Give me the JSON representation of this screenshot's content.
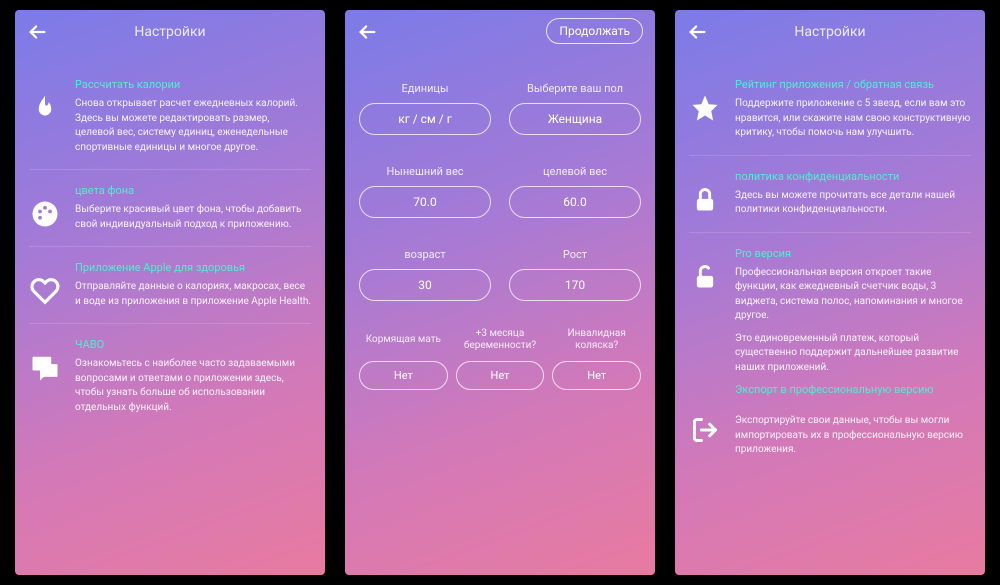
{
  "screen1": {
    "title": "Настройки",
    "items": [
      {
        "title": "Рассчитать калории",
        "desc": "Снова открывает расчет ежедневных калорий. Здесь вы можете редактировать размер, целевой вес, систему единиц, еженедельные спортивные единицы и многое другое."
      },
      {
        "title": "цвета фона",
        "desc": "Выберите красивый цвет фона, чтобы добавить свой индивидуальный подход к приложению."
      },
      {
        "title": "Приложение Apple для здоровья",
        "desc": "Отправляйте данные о калориях, макросах, весе и воде из приложения в приложение Apple Health."
      },
      {
        "title": "ЧАВО",
        "desc": "Ознакомьтесь с наиболее часто задаваемыми вопросами и ответами о приложении здесь, чтобы узнать больше об использовании отдельных функций."
      }
    ]
  },
  "screen2": {
    "continue": "Продолжать",
    "fields": {
      "units": {
        "label": "Единицы",
        "value": "кг / см / г"
      },
      "gender": {
        "label": "Выберите ваш пол",
        "value": "Женщина"
      },
      "current_weight": {
        "label": "Нынешний вес",
        "value": "70.0"
      },
      "target_weight": {
        "label": "целевой вес",
        "value": "60.0"
      },
      "age": {
        "label": "возраст",
        "value": "30"
      },
      "height": {
        "label": "Рост",
        "value": "170"
      },
      "nursing": {
        "label": "Кормящая мать",
        "value": "Нет"
      },
      "pregnant": {
        "label": "+3 месяца беременности?",
        "value": "Нет"
      },
      "wheelchair": {
        "label": "Инвалидная коляска?",
        "value": "Нет"
      }
    }
  },
  "screen3": {
    "title": "Настройки",
    "items": [
      {
        "title": "Рейтинг приложения / обратная связь",
        "desc": "Поддержите приложение с 5 звезд, если вам это нравится, или скажите нам свою конструктивную критику, чтобы помочь нам улучшить."
      },
      {
        "title": "политика конфиденциальности",
        "desc": "Здесь вы можете прочитать все детали нашей политики конфиденциальности."
      },
      {
        "title": "Pro версия",
        "desc": "Профессиональная версия откроет такие функции, как ежедневный счетчик воды, 3 виджета, система полос, напоминания и многое другое.",
        "extra": "Это единовременный платеж, который существенно поддержит дальнейшее развитие наших приложений.",
        "link": "Экспорт в профессиональную версию",
        "linkdesc": "Экспортируйте свои данные, чтобы вы могли импортировать их в профессиональную версию приложения."
      }
    ]
  }
}
